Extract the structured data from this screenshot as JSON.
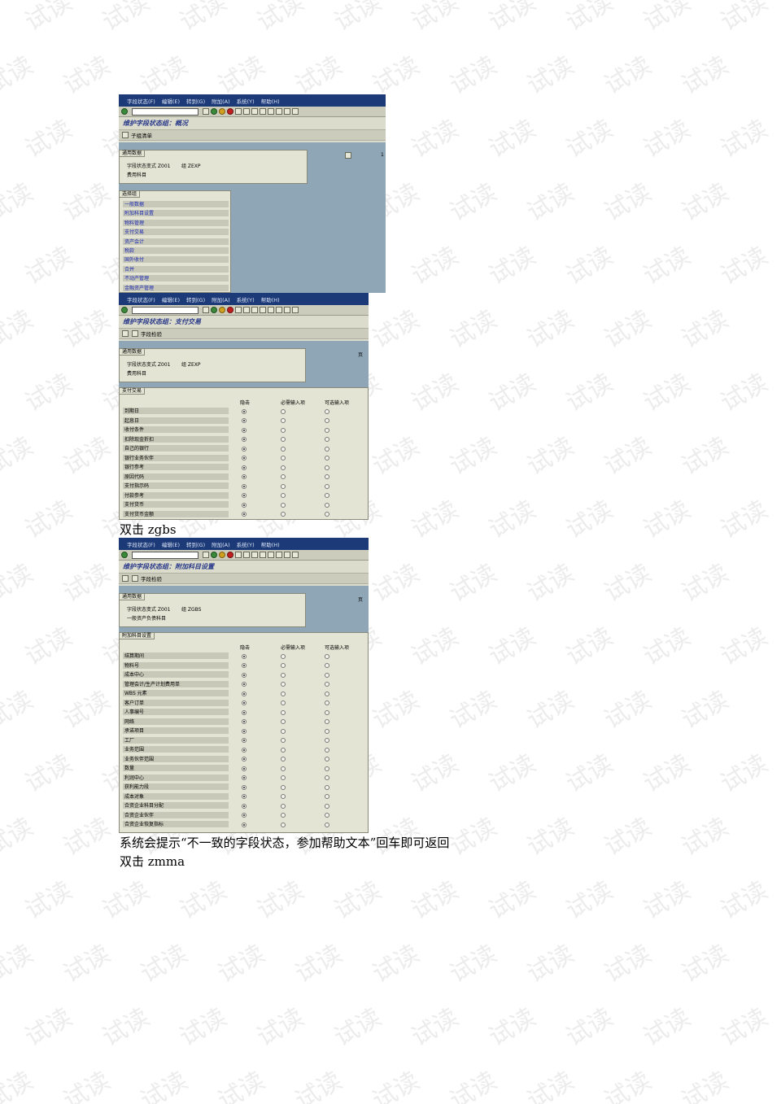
{
  "watermark": "试读",
  "screens": {
    "overview": {
      "menu": [
        "字段状态(F)",
        "编辑(E)",
        "转到(G)",
        "附加(A)",
        "系统(Y)",
        "帮助(H)"
      ],
      "title": "维护字段状态组：概况",
      "app_button": "子组清单",
      "general_label": "通用数据",
      "variant_line": "字段状态变式 Z001",
      "group_line": "组 ZEXP",
      "desc_line": "费用科目",
      "page_marker": "1",
      "select_label": "选择组",
      "select_items": [
        "一般数据",
        "附加科目设置",
        "物料管理",
        "支付交易",
        "资产会计",
        "税款",
        "国外收付",
        "合并",
        "不动产管理",
        "金融资产管理"
      ]
    },
    "payment": {
      "menu": [
        "字段状态(F)",
        "编辑(E)",
        "转到(G)",
        "附加(A)",
        "系统(Y)",
        "帮助(H)"
      ],
      "title": "维护字段状态组：支付交易",
      "app_button": "字段检验",
      "general_label": "通用数据",
      "variant_line": "字段状态变式 Z001",
      "group_line": "组 ZEXP",
      "desc_line": "费用科目",
      "page_label": "页",
      "section_label": "支付交易",
      "col_suppress": "隐击",
      "col_required": "必需输入项",
      "col_optional": "可选输入项",
      "fields": [
        "到期日",
        "起息日",
        "收付条件",
        "扣除现金折扣",
        "自己的银行",
        "银行业务伙伴",
        "银行参考",
        "原因代码",
        "支付指示码",
        "付款参考",
        "支付货币",
        "支付货币金额"
      ]
    },
    "additional": {
      "menu": [
        "字段状态(F)",
        "编辑(E)",
        "转到(G)",
        "附加(A)",
        "系统(Y)",
        "帮助(H)"
      ],
      "title": "维护字段状态组：附加科目设置",
      "app_button": "字段检验",
      "general_label": "通用数据",
      "variant_line": "字段状态变式 Z001",
      "group_line": "组 ZGBS",
      "desc_line": "一般资产负债科目",
      "page_label": "页",
      "section_label": "附加科目设置",
      "col_suppress": "隐击",
      "col_required": "必需输入项",
      "col_optional": "可选输入项",
      "fields": [
        "结算期间",
        "物料号",
        "成本中心",
        "管理会计/生产计划费用单",
        "WBS 元素",
        "客户订单",
        "人事编号",
        "网络",
        "承诺项目",
        "工厂",
        "业务范围",
        "业务伙伴范围",
        "数量",
        "利润中心",
        "获利能力段",
        "成本对象",
        "合资企业科目分配",
        "合资企业伙伴",
        "合资企业恢复指标"
      ]
    }
  },
  "captions": {
    "c1": "双击 zgbs",
    "c2": "系统会提示“不一致的字段状态，参加帮助文本”回车即可返回",
    "c3": "双击 zmma"
  }
}
